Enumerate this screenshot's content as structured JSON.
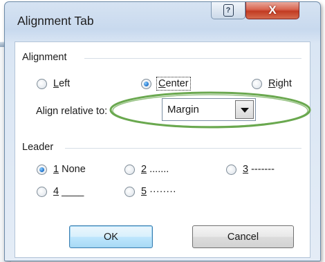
{
  "dialog": {
    "title": "Alignment Tab",
    "help_icon": "question-mark-icon",
    "close_icon": "close-x-icon",
    "close_symbol": "X"
  },
  "alignment": {
    "section_label": "Alignment",
    "options": [
      {
        "accel": "L",
        "rest": "eft",
        "selected": false
      },
      {
        "accel": "C",
        "rest": "enter",
        "selected": true
      },
      {
        "accel": "R",
        "rest": "ight",
        "selected": false
      }
    ],
    "relative_label": "Align relative to:",
    "relative_value": "Margin"
  },
  "leader": {
    "section_label": "Leader",
    "options": [
      {
        "accel": "1",
        "rest": " None",
        "selected": true
      },
      {
        "accel": "2",
        "rest": " .......",
        "selected": false
      },
      {
        "accel": "3",
        "rest": " -------",
        "selected": false
      },
      {
        "accel": "4",
        "rest": " ____",
        "selected": false
      },
      {
        "accel": "5",
        "rest": " ········",
        "selected": false
      }
    ]
  },
  "buttons": {
    "ok": "OK",
    "cancel": "Cancel"
  },
  "colors": {
    "annotation_ellipse": "#6aa84f"
  }
}
